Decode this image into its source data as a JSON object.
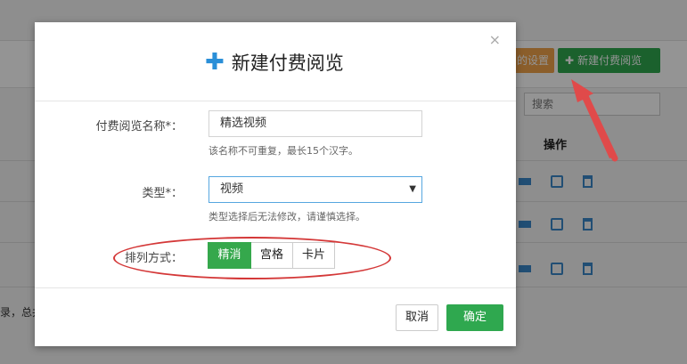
{
  "background": {
    "buttons": {
      "settings_label": "的设置",
      "new_label": "新建付费阅览"
    },
    "search_placeholder": "搜索",
    "table_header_action": "操作",
    "footer_text": "录，总共"
  },
  "modal": {
    "title": "新建付费阅览",
    "close_symbol": "×",
    "name_field": {
      "label": "付费阅览名称*：",
      "value": "精选视频",
      "help": "该名称不可重复，最长15个汉字。"
    },
    "type_field": {
      "label": "类型*：",
      "selected": "视频",
      "help": "类型选择后无法修改，请谨慎选择。"
    },
    "layout_field": {
      "label": "排列方式：",
      "options": [
        "精消",
        "宫格",
        "卡片"
      ],
      "active_index": 0
    },
    "cancel_label": "取消",
    "confirm_label": "确定"
  },
  "colors": {
    "green": "#2fa84f",
    "orange": "#f0a34a",
    "blue": "#2a8fd8",
    "annotation_red": "#d43838"
  }
}
